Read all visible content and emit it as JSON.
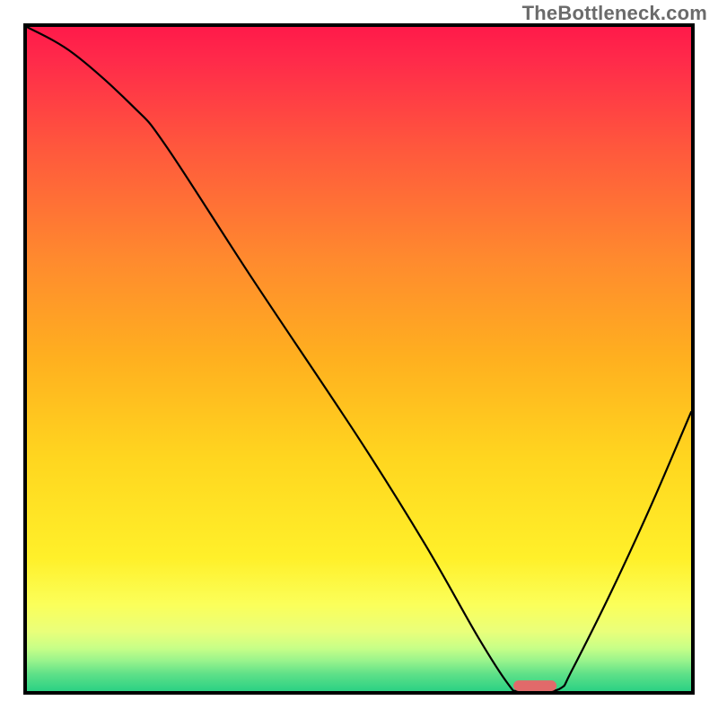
{
  "watermark": "TheBottleneck.com",
  "chart_data": {
    "type": "line",
    "title": "",
    "xlabel": "",
    "ylabel": "",
    "xlim": [
      0,
      100
    ],
    "ylim": [
      0,
      100
    ],
    "grid": false,
    "legend": false,
    "gradient_stops": [
      {
        "offset": 0.0,
        "color": "#ff1a4a"
      },
      {
        "offset": 0.05,
        "color": "#ff2a4a"
      },
      {
        "offset": 0.18,
        "color": "#ff573d"
      },
      {
        "offset": 0.35,
        "color": "#ff8a2e"
      },
      {
        "offset": 0.5,
        "color": "#ffb01f"
      },
      {
        "offset": 0.65,
        "color": "#ffd61f"
      },
      {
        "offset": 0.8,
        "color": "#fff02a"
      },
      {
        "offset": 0.87,
        "color": "#fbff5a"
      },
      {
        "offset": 0.91,
        "color": "#eaff7a"
      },
      {
        "offset": 0.935,
        "color": "#c8ff87"
      },
      {
        "offset": 0.955,
        "color": "#97f38c"
      },
      {
        "offset": 0.975,
        "color": "#5de088"
      },
      {
        "offset": 1.0,
        "color": "#2bd184"
      }
    ],
    "series": [
      {
        "name": "bottleneck-curve",
        "x": [
          0,
          7,
          16,
          21,
          34,
          50,
          60,
          68,
          72.5,
          74,
          78,
          80.5,
          82,
          88,
          94,
          100
        ],
        "y": [
          100,
          96,
          88,
          82,
          62,
          38,
          22,
          8,
          1,
          0,
          0,
          0.5,
          3,
          15,
          28,
          42
        ]
      }
    ],
    "marker": {
      "name": "optimal-point",
      "x": 76.5,
      "y": 0,
      "width": 6.5,
      "height": 1.6,
      "color": "#e16a6a"
    }
  }
}
